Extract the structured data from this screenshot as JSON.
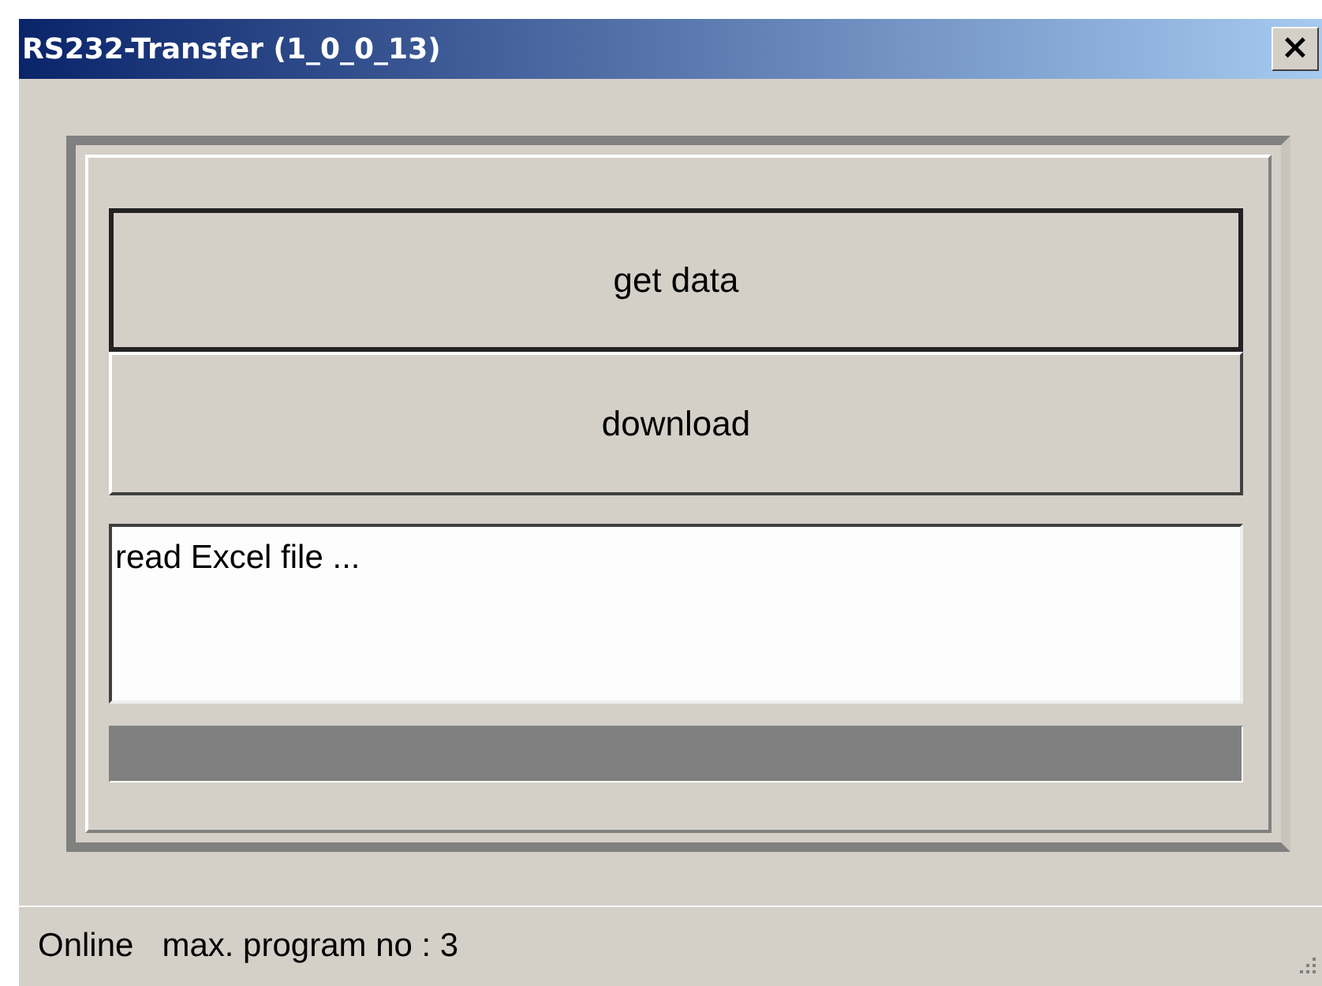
{
  "window": {
    "title": "RS232-Transfer (1_0_0_13)",
    "close": "×"
  },
  "buttons": [
    {
      "label": "get data",
      "default": true
    },
    {
      "label": "download",
      "default": false
    }
  ],
  "log": {
    "value": "read Excel file ..."
  },
  "status_bar": {
    "items": [
      "Online",
      "max. program no : 3"
    ]
  }
}
